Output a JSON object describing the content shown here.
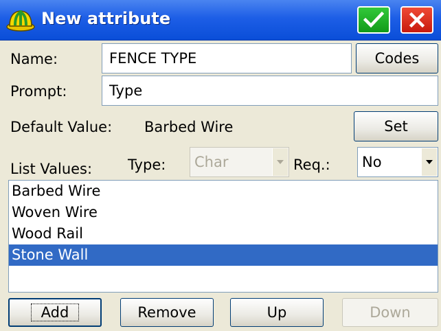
{
  "window": {
    "title": "New attribute"
  },
  "form": {
    "name_label": "Name:",
    "name_value": "FENCE TYPE",
    "codes_button": "Codes",
    "prompt_label": "Prompt:",
    "prompt_value": "Type",
    "default_label": "Default Value:",
    "default_value": "Barbed Wire",
    "set_button": "Set",
    "list_values_label": "List Values:",
    "type_label": "Type:",
    "type_value": "Char",
    "req_label": "Req.:",
    "req_value": "No"
  },
  "list": {
    "items": [
      {
        "label": "Barbed Wire",
        "selected": false
      },
      {
        "label": "Woven Wire",
        "selected": false
      },
      {
        "label": "Wood Rail",
        "selected": false
      },
      {
        "label": "Stone Wall",
        "selected": true
      }
    ]
  },
  "buttons": {
    "add": "Add",
    "remove": "Remove",
    "up": "Up",
    "down": "Down"
  },
  "colors": {
    "titlebar": "#1d5ee6",
    "selection": "#316ac5",
    "ok": "#22b82a",
    "close": "#e03220",
    "dialog_bg": "#ece9d8"
  },
  "icons": {
    "app": "hardhat-icon",
    "ok": "checkmark-icon",
    "close": "close-x-icon",
    "dropdown": "dropdown-arrow-icon"
  }
}
